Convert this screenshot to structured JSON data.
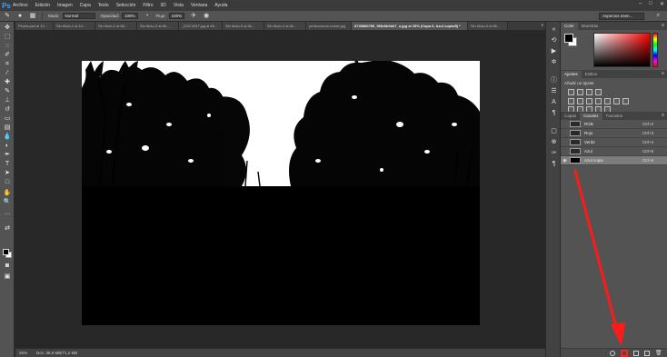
{
  "app": {
    "logo": "Ps"
  },
  "menu": [
    "Archivo",
    "Edición",
    "Imagen",
    "Capa",
    "Texto",
    "Selección",
    "Filtro",
    "3D",
    "Vista",
    "Ventana",
    "Ayuda"
  ],
  "window_controls": [
    "minimize-icon",
    "maximize-icon",
    "close-icon"
  ],
  "options_bar": {
    "mode_label": "Modo:",
    "mode_value": "Normal",
    "opacity_label": "Opacidad:",
    "opacity_value": "100%",
    "flow_label": "Flujo:",
    "flow_value": "100%",
    "workspace_value": "Aspectos esen..."
  },
  "document_tabs": [
    {
      "label": "Pluma.psd al 10...",
      "active": false
    },
    {
      "label": "Sin título-1 al 10...",
      "active": false
    },
    {
      "label": "Sin título-2 al 66...",
      "active": false
    },
    {
      "label": "Sin título-3 al 66...",
      "active": false
    },
    {
      "label": "_DSC4267.jpg al 66...",
      "active": false
    },
    {
      "label": "Sin título-5 al 66...",
      "active": false
    },
    {
      "label": "Sin título-4 al 66...",
      "active": false
    },
    {
      "label": "perfeccionar-borde.jpg",
      "active": false
    },
    {
      "label": "8745880789_9f4b6b0b67_o.jpg al 25% (Capa 0, Azul copia/8) *",
      "active": true
    },
    {
      "label": "Sin título-6 al 66...",
      "active": false
    }
  ],
  "status_bar": {
    "zoom": "25%",
    "doc_size": "Doc: 36,9 MB/71,2 MB"
  },
  "color_panel": {
    "tabs": [
      "Color",
      "Muestras"
    ],
    "active_tab": "Color",
    "foreground": "#000000",
    "background": "#ffffff"
  },
  "adjustments_panel": {
    "tabs": [
      "Ajustes",
      "Estilos"
    ],
    "active_tab": "Ajustes",
    "title": "Añadir un ajuste"
  },
  "layers_panel": {
    "tabs": [
      "Capas",
      "Canales",
      "Trazados"
    ],
    "active_tab": "Canales",
    "rows": [
      {
        "name": "RGB",
        "shortcut": "Ctrl+2",
        "selected": false
      },
      {
        "name": "Rojo",
        "shortcut": "Ctrl+3",
        "selected": false
      },
      {
        "name": "Verde",
        "shortcut": "Ctrl+4",
        "selected": false
      },
      {
        "name": "Azul",
        "shortcut": "Ctrl+5",
        "selected": false
      },
      {
        "name": "Azul copia",
        "shortcut": "Ctrl+6",
        "selected": true
      }
    ]
  },
  "colors": {
    "accent_red": "#ff2020",
    "ps_blue": "#31a8ff"
  }
}
